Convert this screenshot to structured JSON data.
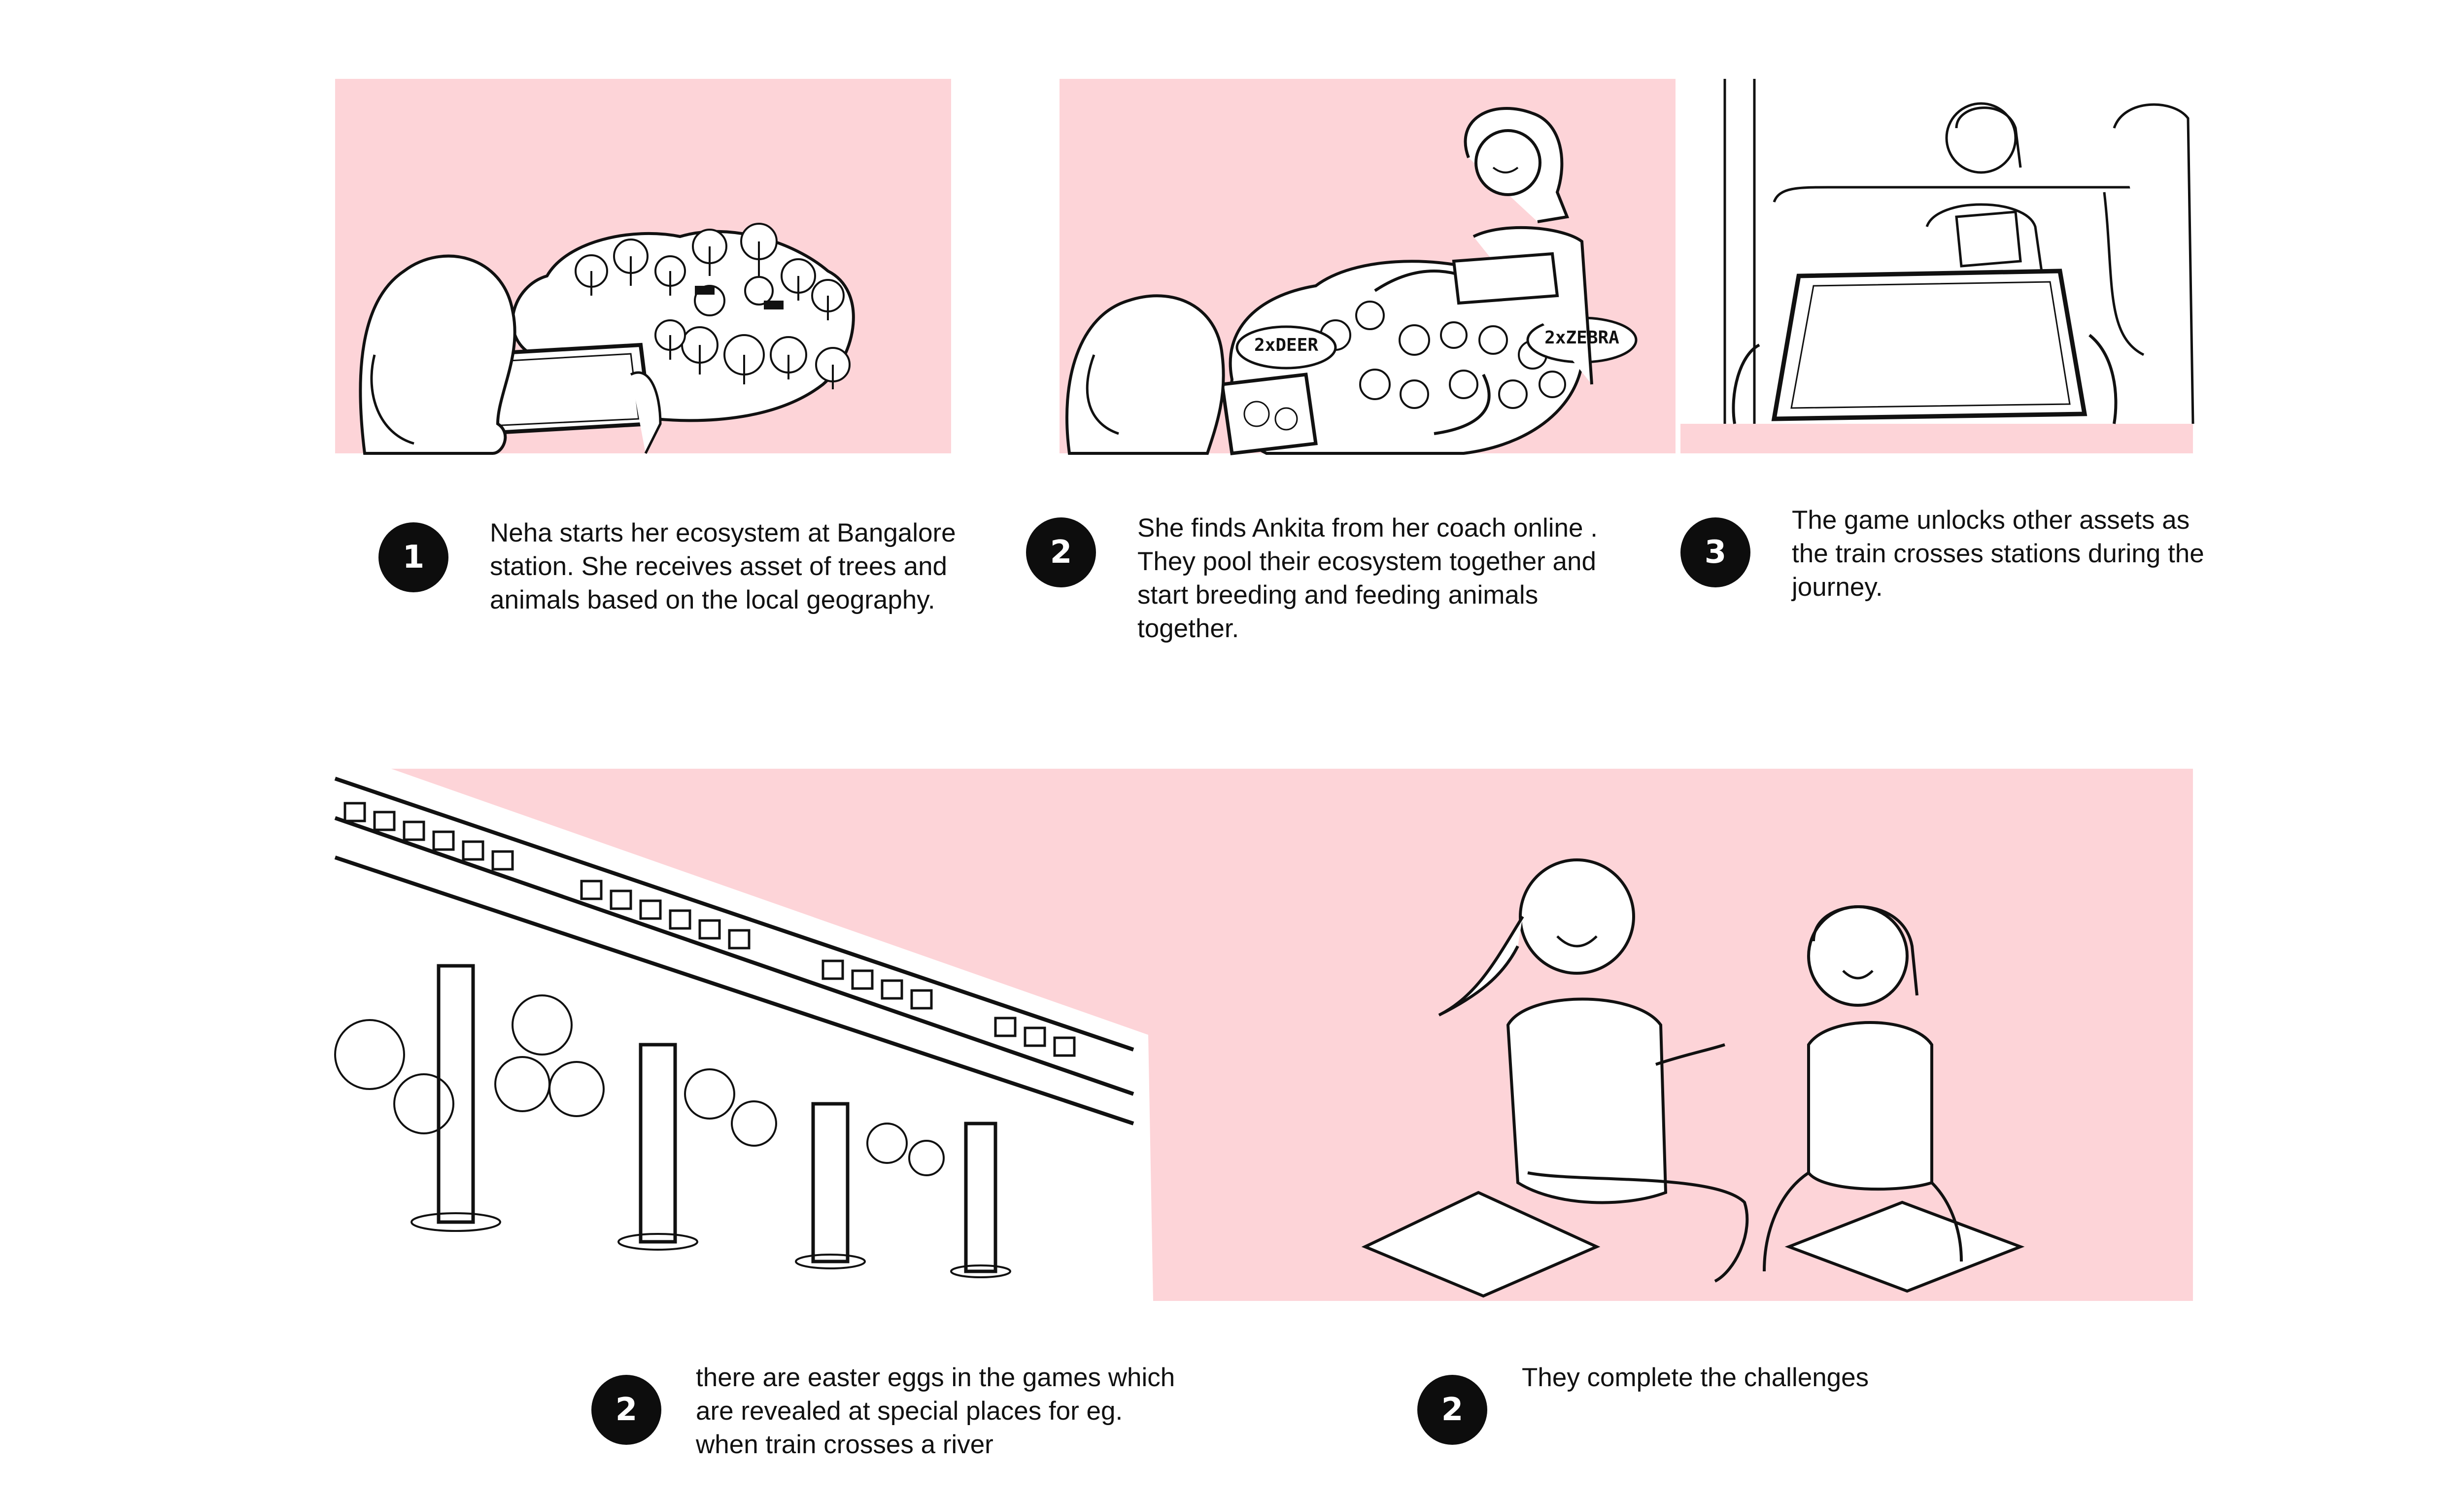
{
  "panels": [
    {
      "badge": "1",
      "caption": "Neha starts her ecosystem at Bangalore station. She receives asset of trees and animals based on the local geography."
    },
    {
      "badge": "2",
      "caption": "She finds Ankita from her coach online . They pool their ecosystem together and start breeding and feeding animals together.",
      "labels": [
        "2xDEER",
        "2xZEBRA"
      ]
    },
    {
      "badge": "3",
      "caption": "The game unlocks other assets as the train crosses stations during the journey."
    },
    {
      "badge": "2",
      "caption": "there are easter eggs in the games which are revealed at special places for eg. when train crosses a river"
    },
    {
      "badge": "2",
      "caption": "They complete the challenges"
    }
  ],
  "colors": {
    "panel_background": "#fdd4d8",
    "badge": "#0d0d0d",
    "ink": "#111111"
  }
}
